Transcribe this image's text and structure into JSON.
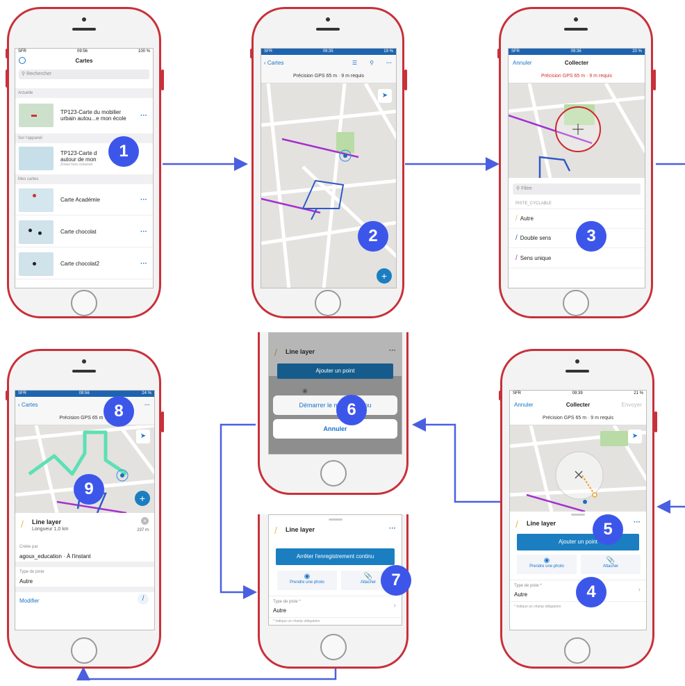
{
  "steps": {
    "s1": "1",
    "s2": "2",
    "s3": "3",
    "s4": "4",
    "s5": "5",
    "s6": "6",
    "s7": "7",
    "s8": "8",
    "s9": "9"
  },
  "colors": {
    "phone_frame": "#c8303a",
    "badge": "#3d56ea",
    "arrow": "#4a5fe0",
    "accent_blue": "#1b7ec1",
    "purple_line": "#a52fd0",
    "blue_line": "#2f59c7",
    "teal_line": "#5de0b5"
  },
  "phone1": {
    "status": {
      "carrier": "SFR",
      "time": "09:56",
      "battery": "100 %"
    },
    "title": "Cartes",
    "search_placeholder": "Rechercher",
    "section_current": "Actuelle",
    "section_device": "Sur l'appareil",
    "section_mine": "Mes cartes",
    "item_current_1": "TP123-Carte du mobilier",
    "item_current_2": "urbain autou...e mon école",
    "item_device_1": "TP123-Carte d",
    "item_device_2": "autour de mon",
    "item_device_note": "Zones hors connexio",
    "item_mine": [
      "Carte Académie",
      "Carte chocolat",
      "Carte chocolat2"
    ]
  },
  "phone2": {
    "status": {
      "carrier": "SFR",
      "time": "09:35",
      "battery": "19 %"
    },
    "back": "Cartes",
    "gps": "Précision GPS 65 m · 9 m requis"
  },
  "phone3": {
    "status": {
      "carrier": "SFR",
      "time": "09:36",
      "battery": "20 %"
    },
    "cancel": "Annuler",
    "title": "Collecter",
    "gps": "Précision GPS 65 m · 9 m requis",
    "filter_placeholder": "Filtre",
    "group": "PISTE_CYCLABLE",
    "types": [
      "Autre",
      "Double sens",
      "Sens unique"
    ]
  },
  "phone4": {
    "status": {
      "carrier": "SFR",
      "time": "09:39",
      "battery": "21 %"
    },
    "cancel": "Annuler",
    "title": "Collecter",
    "send": "Envoyer",
    "gps": "Précision GPS 65 m · 9 m requis",
    "layer": "Line layer",
    "add_point": "Ajouter un point",
    "photo": "Prendre une photo",
    "attach": "Attacher",
    "field_label": "Type de piste *",
    "field_value": "Autre",
    "required_note": "* Indique un champ obligatoire"
  },
  "phone6": {
    "layer": "Line layer",
    "add_point": "Ajouter un point",
    "start_continuous": "Démarrer le mode continu",
    "cancel": "Annuler"
  },
  "phone7": {
    "layer": "Line layer",
    "stop_continuous": "Arrêter l'enregistrement continu",
    "photo": "Prendre une photo",
    "attach": "Attacher",
    "field_label": "Type de piste *",
    "field_value": "Autre",
    "required_note": "* Indique un champ obligatoire"
  },
  "phone8": {
    "status": {
      "carrier": "SFR",
      "time": "09:56",
      "battery": "24 %"
    },
    "back": "Cartes",
    "gps": "Précision GPS 65 m · 9",
    "layer": "Line layer",
    "length": "Longueur 1,0 km",
    "dist": "237 m",
    "created_label": "Créée par",
    "created_value": "agoux_education · À l'instant",
    "type_label": "Type de piste",
    "type_value": "Autre",
    "modify": "Modifier"
  }
}
